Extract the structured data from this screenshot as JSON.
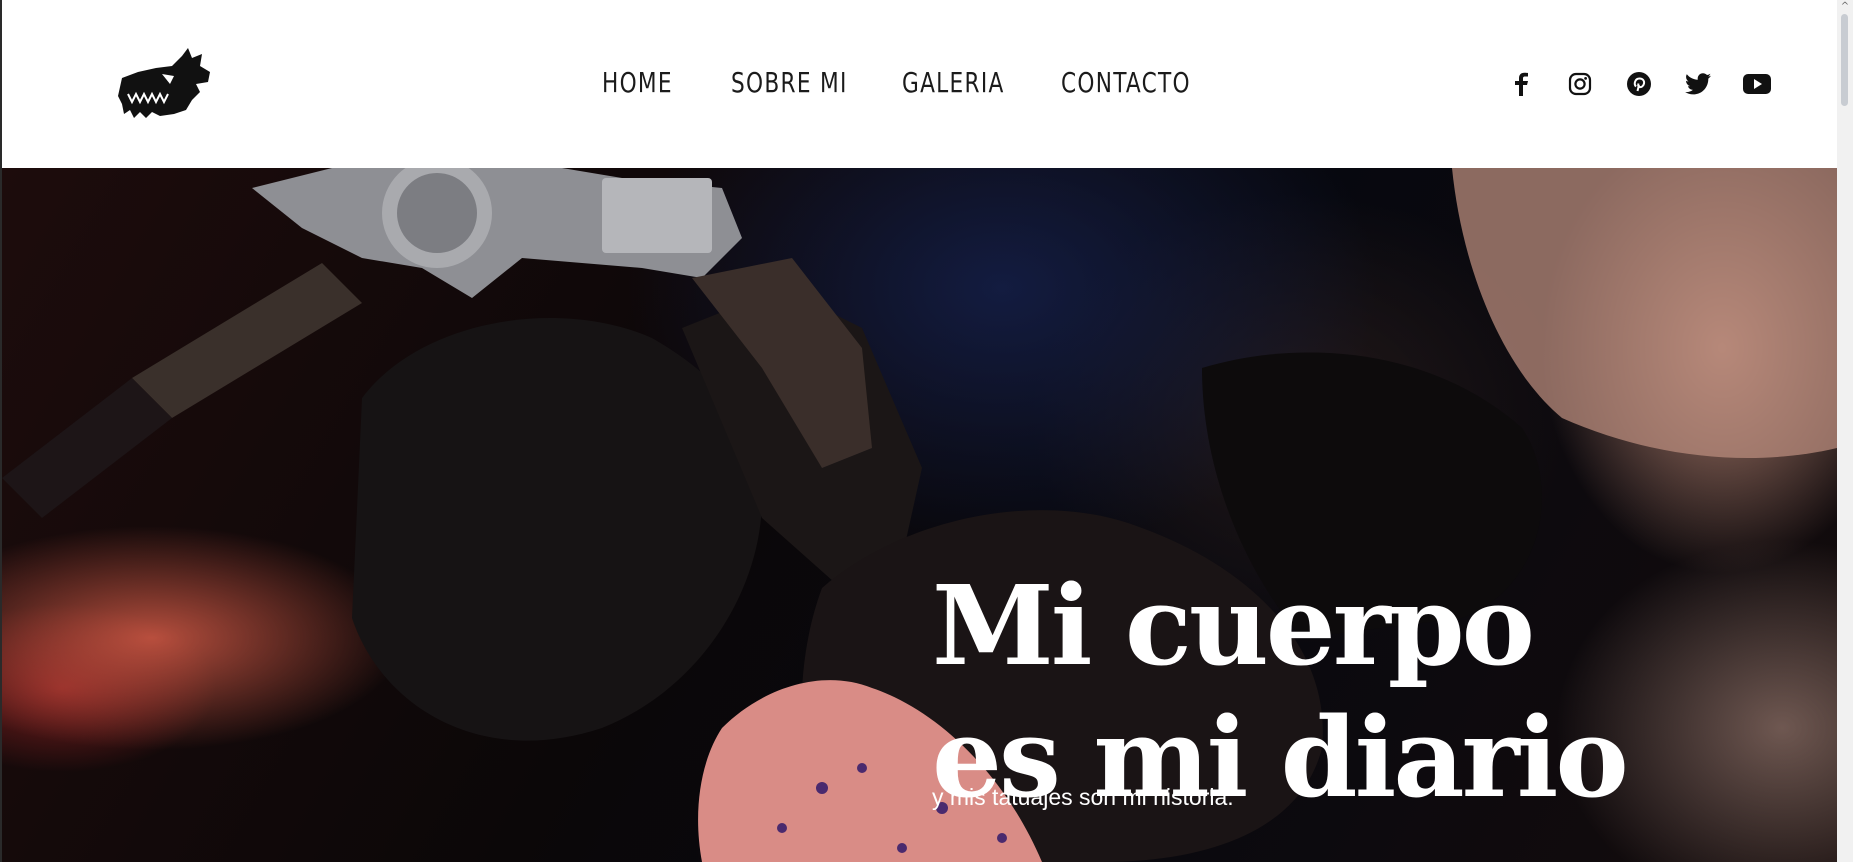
{
  "header": {
    "logo_icon": "dragon-skull-icon",
    "nav": [
      {
        "label": "HOME"
      },
      {
        "label": "SOBRE MI"
      },
      {
        "label": "GALERIA"
      },
      {
        "label": "CONTACTO"
      }
    ],
    "social_icons": [
      "facebook-icon",
      "instagram-icon",
      "pinterest-icon",
      "twitter-icon",
      "youtube-icon"
    ]
  },
  "hero": {
    "headline_line1": "Mi cuerpo",
    "headline_line2": "es mi diario",
    "subtitle": "y mis tatuajes son mi historia."
  },
  "colors": {
    "nav_text": "#1b1b1b",
    "hero_text": "#ffffff",
    "header_bg": "#ffffff"
  }
}
